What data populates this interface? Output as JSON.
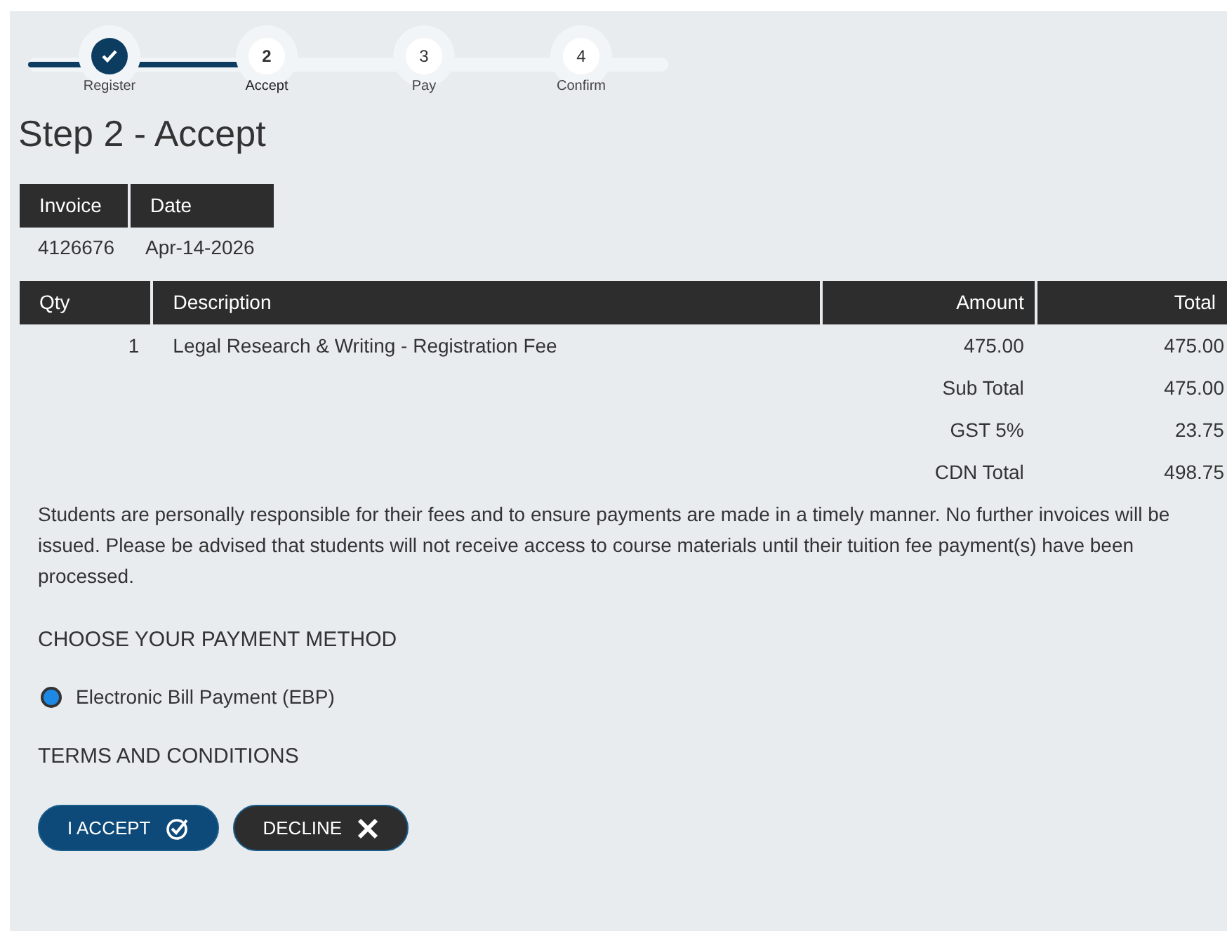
{
  "steps": [
    {
      "label": "Register",
      "completed": true,
      "selected": false
    },
    {
      "number": "2",
      "label": "Accept",
      "completed": false,
      "selected": true
    },
    {
      "number": "3",
      "label": "Pay",
      "completed": false,
      "selected": false
    },
    {
      "number": "4",
      "label": "Confirm",
      "completed": false,
      "selected": false
    }
  ],
  "heading": "Step 2 - Accept",
  "invoice": {
    "columns": [
      "Invoice",
      "Date"
    ],
    "values": [
      "4126676",
      "Apr-14-2026"
    ]
  },
  "table": {
    "columns": [
      "Qty",
      "Description",
      "Amount",
      "Total"
    ],
    "rows": [
      {
        "qty": "1",
        "description": "Legal Research & Writing - Registration Fee",
        "amount": "475.00",
        "total": "475.00"
      }
    ],
    "summary": [
      {
        "label": "Sub Total",
        "value": "475.00"
      },
      {
        "label": "GST 5%",
        "value": "23.75"
      },
      {
        "label": "CDN Total",
        "value": "498.75"
      }
    ]
  },
  "notice": "Students are personally responsible for their fees and to ensure payments are made in a timely manner. No further invoices will be issued. Please be advised that students will not receive access to course materials until their tuition fee payment(s) have been processed.",
  "payment_heading": "CHOOSE YOUR PAYMENT METHOD",
  "payment_options": [
    {
      "label": "Electronic Bill Payment (EBP)",
      "selected": true
    }
  ],
  "terms_heading": "TERMS AND CONDITIONS",
  "buttons": [
    {
      "label": "I ACCEPT",
      "kind": "accept"
    },
    {
      "label": "DECLINE",
      "kind": "decline"
    }
  ]
}
